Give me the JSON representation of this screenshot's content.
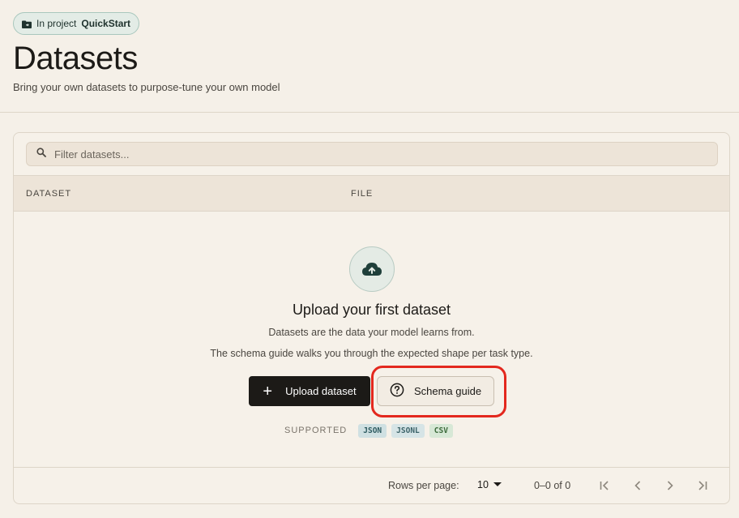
{
  "project": {
    "prefix": "In project",
    "name": "QuickStart",
    "icon": "folder-icon"
  },
  "header": {
    "title": "Datasets",
    "subtitle": "Bring your own datasets to purpose-tune your own model"
  },
  "search": {
    "placeholder": "Filter datasets...",
    "value": "",
    "icon": "search-icon"
  },
  "table": {
    "columns": [
      "DATASET",
      "FILE"
    ]
  },
  "empty_state": {
    "icon": "cloud-upload-icon",
    "title": "Upload your first dataset",
    "description1": "Datasets are the data your model learns from.",
    "description2": "The schema guide walks you through the expected shape per task type.",
    "upload_label": "Upload dataset",
    "schema_label": "Schema guide",
    "supported_label": "SUPPORTED",
    "formats": [
      "JSON",
      "JSONL",
      "CSV"
    ]
  },
  "pagination": {
    "rows_per_page_label": "Rows per page:",
    "rows_per_page_value": "10",
    "range": "0–0 of 0"
  },
  "colors": {
    "accent_dark": "#1c1a17",
    "highlight": "#e3281e",
    "teal": "#2d5a60"
  }
}
